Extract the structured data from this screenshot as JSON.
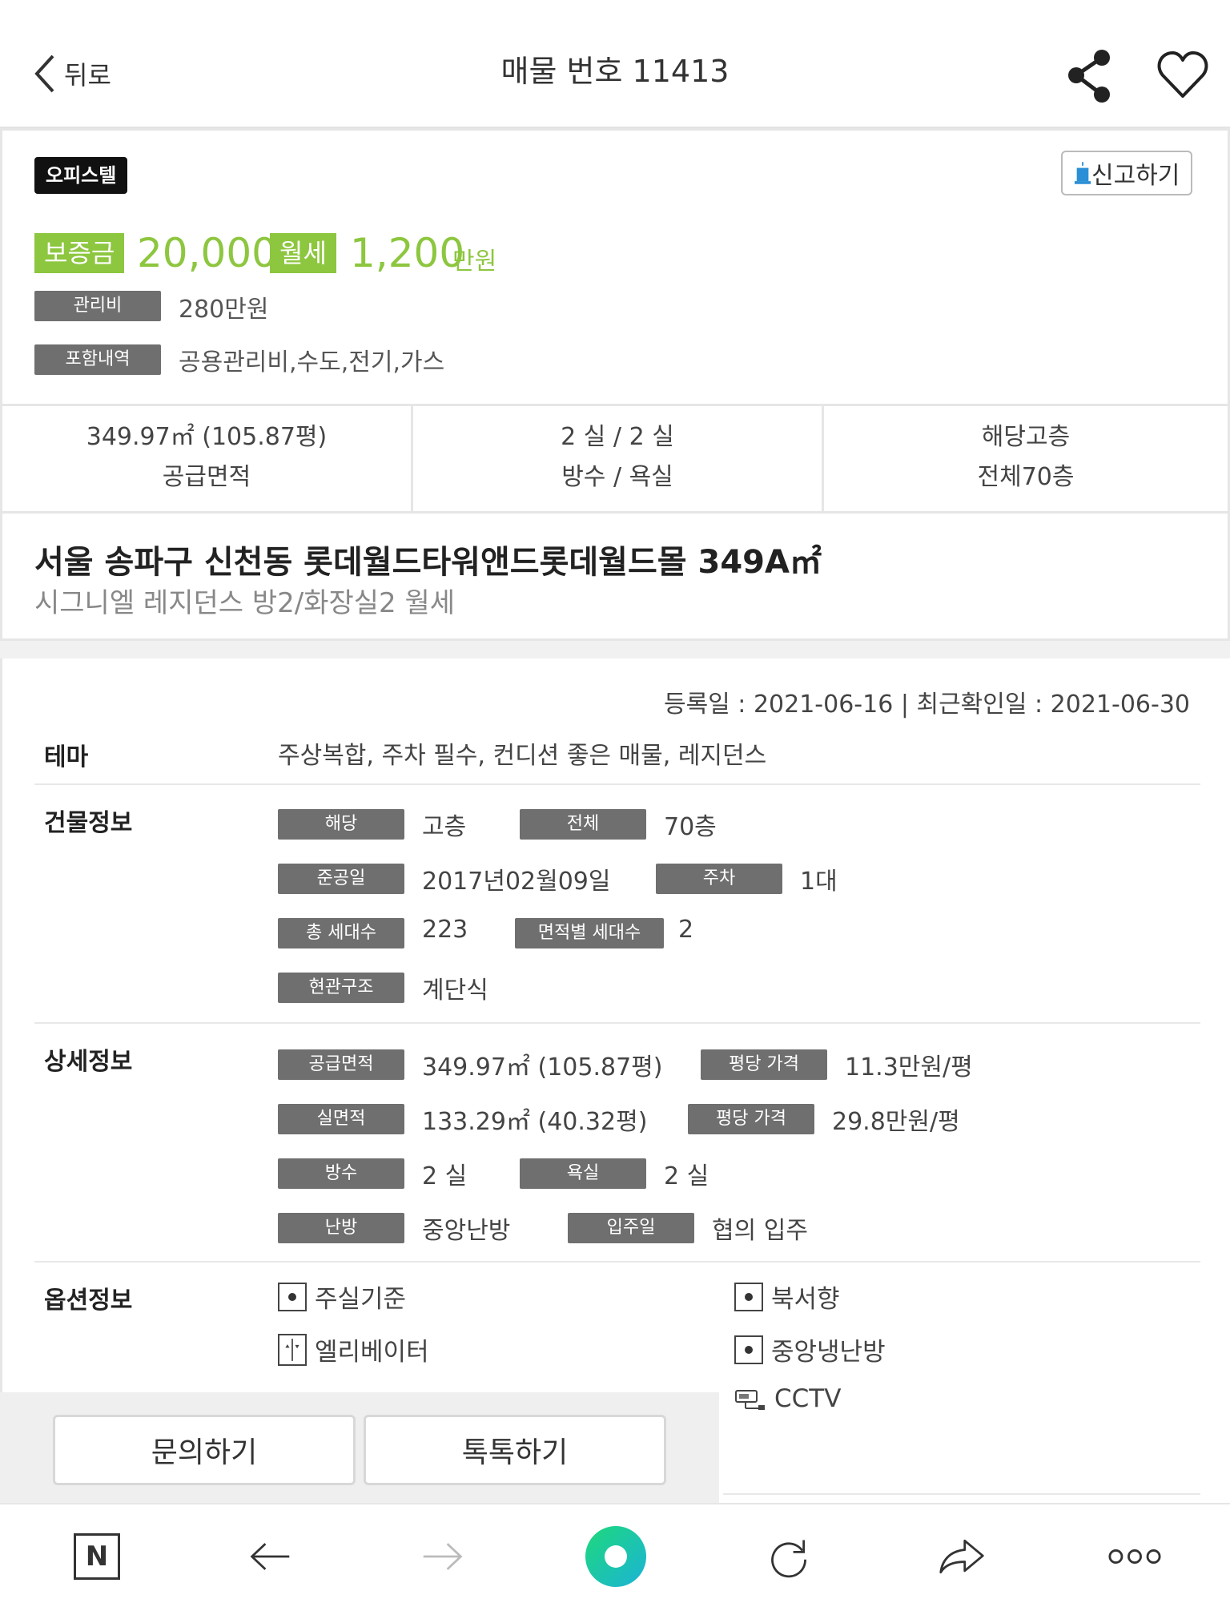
{
  "header": {
    "back_label": "뒤로",
    "title": "매물 번호 11413"
  },
  "listing": {
    "type_tag": "오피스텔",
    "report_label": "신고하기",
    "deposit_label": "보증금",
    "deposit_value": "20,000",
    "rent_label": "월세",
    "rent_value": "1,200",
    "unit": "만원",
    "maintenance_label": "관리비",
    "maintenance_value": "280만원",
    "included_label": "포함내역",
    "included_value": "공용관리비,수도,전기,가스",
    "accent_color": "#8dc63f"
  },
  "stats": [
    {
      "value": "349.97㎡ (105.87평)",
      "label": "공급면적"
    },
    {
      "value": "2 실 / 2 실",
      "label": "방수 / 욕실"
    },
    {
      "value": "해당고층",
      "label": "전체70층"
    }
  ],
  "title": {
    "main": "서울 송파구 신천동 롯데월드타워앤드롯데월드몰 349A㎡",
    "sub": "시그니엘 레지던스 방2/화장실2 월세"
  },
  "detail": {
    "dates": "등록일 : 2021-06-16 | 최근확인일 : 2021-06-30",
    "theme_label": "테마",
    "theme_value": "주상복합, 주차 필수, 컨디션 좋은 매물, 레지던스",
    "building_label": "건물정보",
    "building": {
      "floor_tag": "해당",
      "floor_val": "고층",
      "total_tag": "전체",
      "total_val": "70층",
      "completion_tag": "준공일",
      "completion_val": "2017년02월09일",
      "parking_tag": "주차",
      "parking_val": "1대",
      "households_tag": "총 세대수",
      "households_val": "223",
      "area_households_tag": "면적별 세대수",
      "area_households_val": "2",
      "entrance_tag": "현관구조",
      "entrance_val": "계단식"
    },
    "spec_label": "상세정보",
    "spec": {
      "supply_tag": "공급면적",
      "supply_val": "349.97㎡ (105.87평)",
      "price_tag1": "평당 가격",
      "price_val1": "11.3만원/평",
      "real_tag": "실면적",
      "real_val": "133.29㎡ (40.32평)",
      "price_tag2": "평당 가격",
      "price_val2": "29.8만원/평",
      "rooms_tag": "방수",
      "rooms_val": "2 실",
      "bath_tag": "욕실",
      "bath_val": "2 실",
      "heat_tag": "난방",
      "heat_val": "중앙난방",
      "move_tag": "입주일",
      "move_val": "협의 입주"
    },
    "options_label": "옵션정보",
    "options": {
      "o1": "주실기준",
      "o2": "북서향",
      "o3": "엘리베이터",
      "o4": "중앙냉난방",
      "o5": "CCTV"
    }
  },
  "buttons": {
    "inquiry": "문의하기",
    "talk": "톡톡하기"
  },
  "bottom_nav": {
    "naver": "N"
  }
}
